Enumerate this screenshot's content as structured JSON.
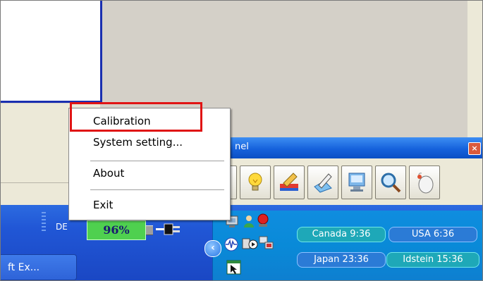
{
  "panel": {
    "title_fragment": "nel",
    "close_glyph": "×",
    "tools": [
      {
        "name": "bulb-icon"
      },
      {
        "name": "eraser-icon"
      },
      {
        "name": "pen-icon"
      },
      {
        "name": "monitor-icon"
      },
      {
        "name": "magnifier-icon"
      },
      {
        "name": "mouse-icon"
      }
    ]
  },
  "context_menu": {
    "items": [
      "Calibration",
      "System setting...",
      "About",
      "Exit"
    ],
    "highlighted_item": "Calibration"
  },
  "taskbar": {
    "language": "DE",
    "battery_percent": "96%",
    "task_button_label": "ft Ex...",
    "tray_arrow_glyph": "‹",
    "clocks": [
      {
        "label": "Canada 9:36",
        "style": "teal"
      },
      {
        "label": "USA 6:36",
        "style": "blue"
      },
      {
        "label": "Japan 23:36",
        "style": "blue"
      },
      {
        "label": "Idstein 15:36",
        "style": "teal"
      }
    ]
  },
  "colors": {
    "highlight_box": "#e01414",
    "taskbar_blue": "#2157d6",
    "tray_blue": "#098ad8",
    "battery_green": "#4fd04f"
  }
}
